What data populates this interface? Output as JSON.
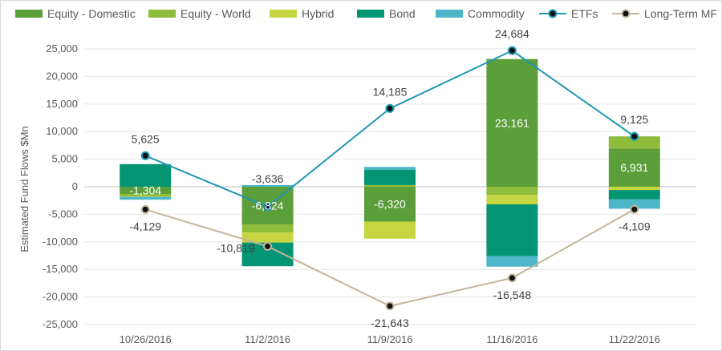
{
  "chart_data": {
    "type": "bar",
    "subtype": "stacked bar with line overlay",
    "categories": [
      "10/26/2016",
      "11/2/2016",
      "11/9/2016",
      "11/16/2016",
      "11/22/2016"
    ],
    "ylabel": "Estimated Fund Flows $Mn",
    "xlabel": "",
    "title": "",
    "ylim": [
      -25000,
      25000
    ],
    "y_ticks": [
      25000,
      20000,
      15000,
      10000,
      5000,
      0,
      -5000,
      -10000,
      -15000,
      -20000,
      -25000
    ],
    "y_tick_labels": [
      "25,000",
      "20,000",
      "15,000",
      "10,000",
      "5,000",
      "0",
      "-5,000",
      "-10,000",
      "-15,000",
      "-20,000",
      "-25,000"
    ],
    "grid": true,
    "legend_position": "top",
    "bar_series": [
      {
        "name": "Equity - Domestic",
        "color": "#5b9e3a",
        "values": [
          -1304,
          -6824,
          -6320,
          23161,
          6931
        ]
      },
      {
        "name": "Equity - World",
        "color": "#8fbc3b",
        "values": [
          -500,
          -1500,
          300,
          -1500,
          2200
        ]
      },
      {
        "name": "Hybrid",
        "color": "#c6d641",
        "values": [
          -50,
          -1800,
          -3100,
          -1700,
          -600
        ]
      },
      {
        "name": "Bond",
        "color": "#039473",
        "values": [
          4100,
          -4300,
          2800,
          -9400,
          -1700
        ]
      },
      {
        "name": "Commodity",
        "color": "#4db6c8",
        "values": [
          -500,
          300,
          500,
          -1900,
          -1700
        ]
      }
    ],
    "bar_labels": [
      "-1,304",
      "-6,824",
      "-6,320",
      "23,161",
      "6,931"
    ],
    "line_series": [
      {
        "name": "ETFs",
        "color": "#1f97b4",
        "values": [
          5625,
          -3636,
          14185,
          24684,
          9125
        ],
        "labels": [
          "5,625",
          "-3,636",
          "14,185",
          "24,684",
          "9,125"
        ]
      },
      {
        "name": "Long-Term MF",
        "color": "#c2b59b",
        "values": [
          -4129,
          -10819,
          -21643,
          -16548,
          -4109
        ],
        "labels": [
          "-4,129",
          "-10,819",
          "-21,643",
          "-16,548",
          "-4,109"
        ]
      }
    ]
  }
}
